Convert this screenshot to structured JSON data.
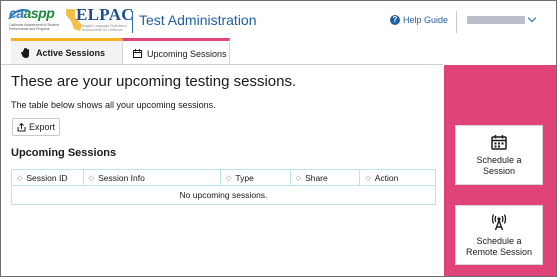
{
  "header": {
    "caaspp_logo": "caaspp",
    "caaspp_tagline": "California Assessment of Student Performance and Progress",
    "elpac_logo": "ELPAC",
    "elpac_tagline": "English Language Proficiency Assessments for California",
    "title": "Test Administration",
    "help_label": "Help Guide",
    "help_icon": "question-circle-icon",
    "user_menu_icon": "chevron-down-icon"
  },
  "tabs": [
    {
      "label": "Active Sessions",
      "icon": "hand-icon",
      "selected": false,
      "accent": "#f7b01e"
    },
    {
      "label": "Upcoming Sessions",
      "icon": "calendar-icon",
      "selected": true,
      "accent": "#e0457b"
    }
  ],
  "main": {
    "title": "These are your upcoming testing sessions.",
    "description": "The table below shows all your upcoming sessions.",
    "export_label": "Export",
    "section_title": "Upcoming Sessions",
    "table": {
      "columns": [
        "Session ID",
        "Session Info",
        "Type",
        "Share",
        "Action"
      ],
      "empty_message": "No upcoming sessions."
    }
  },
  "side_panel": {
    "background": "#e0437a",
    "schedule_session_label": "Schedule a Session",
    "schedule_remote_label": "Schedule a Remote Session"
  }
}
